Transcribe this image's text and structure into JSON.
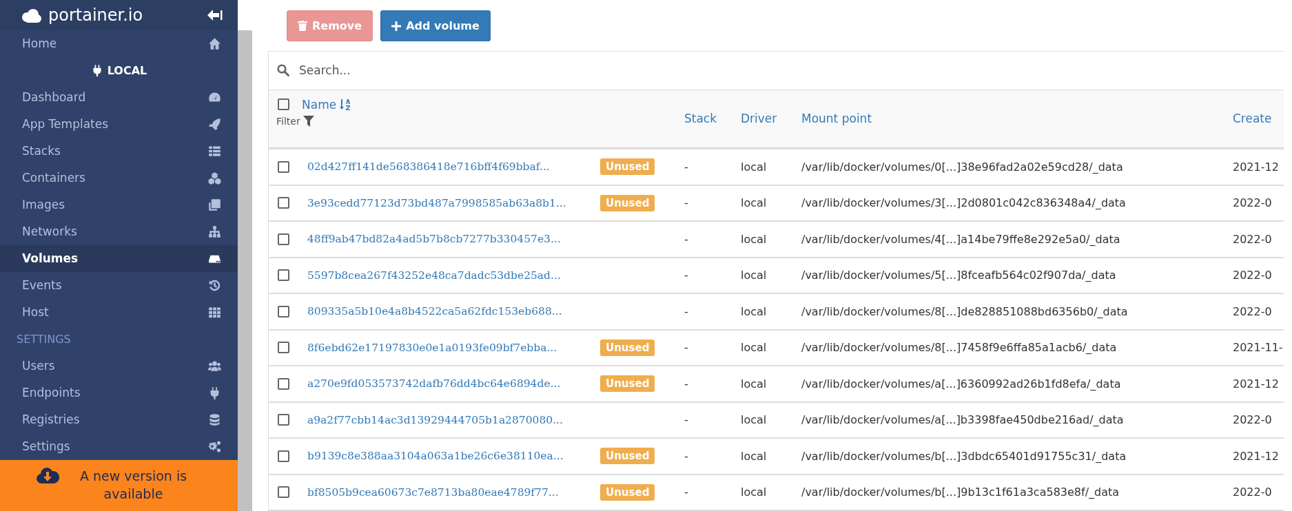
{
  "sidebar": {
    "logo": "portainer.io",
    "items": [
      {
        "kind": "link",
        "label": "Home",
        "selected": false
      },
      {
        "kind": "endpoint",
        "label": "LOCAL"
      },
      {
        "kind": "link",
        "label": "Dashboard",
        "selected": false
      },
      {
        "kind": "link",
        "label": "App Templates",
        "selected": false
      },
      {
        "kind": "link",
        "label": "Stacks",
        "selected": false
      },
      {
        "kind": "link",
        "label": "Containers",
        "selected": false
      },
      {
        "kind": "link",
        "label": "Images",
        "selected": false
      },
      {
        "kind": "link",
        "label": "Networks",
        "selected": false
      },
      {
        "kind": "link",
        "label": "Volumes",
        "selected": true
      },
      {
        "kind": "link",
        "label": "Events",
        "selected": false
      },
      {
        "kind": "link",
        "label": "Host",
        "selected": false
      },
      {
        "kind": "heading",
        "label": "SETTINGS"
      },
      {
        "kind": "link",
        "label": "Users",
        "selected": false
      },
      {
        "kind": "link",
        "label": "Endpoints",
        "selected": false
      },
      {
        "kind": "link",
        "label": "Registries",
        "selected": false
      },
      {
        "kind": "link",
        "label": "Settings",
        "selected": false
      }
    ],
    "update_notice": "A new version is available"
  },
  "toolbar": {
    "buttons": [
      {
        "kind": "remove",
        "label": "Remove",
        "disabled": true
      },
      {
        "kind": "add",
        "label": "Add volume",
        "disabled": false
      }
    ]
  },
  "search": {
    "placeholder": "Search..."
  },
  "table": {
    "select_all": {
      "checked": false
    },
    "filter": "Filter",
    "columns": [
      {
        "label": "Name"
      },
      {
        "label": "Stack"
      },
      {
        "label": "Driver"
      },
      {
        "label": "Mount point"
      },
      {
        "label": "Create"
      }
    ],
    "rows": [
      {
        "checked": false,
        "name": "02d427ff141de568386418e716bff4f69bbaf...",
        "badge": "Unused",
        "stack": "-",
        "driver": "local",
        "mount_point": "/var/lib/docker/volumes/0[...]38e96fad2a02e59cd28/_data",
        "created": "2021-12"
      },
      {
        "checked": false,
        "name": "3e93cedd77123d73bd487a7998585ab63a8b1...",
        "badge": "Unused",
        "stack": "-",
        "driver": "local",
        "mount_point": "/var/lib/docker/volumes/3[...]2d0801c042c836348a4/_data",
        "created": "2022-0"
      },
      {
        "checked": false,
        "name": "48ff9ab47bd82a4ad5b7b8cb7277b330457e3...",
        "stack": "-",
        "driver": "local",
        "mount_point": "/var/lib/docker/volumes/4[...]a14be79ffe8e292e5a0/_data",
        "created": "2022-0"
      },
      {
        "checked": false,
        "name": "5597b8cea267f43252e48ca7dadc53dbe25ad...",
        "stack": "-",
        "driver": "local",
        "mount_point": "/var/lib/docker/volumes/5[...]8fceafb564c02f907da/_data",
        "created": "2022-0"
      },
      {
        "checked": false,
        "name": "809335a5b10e4a8b4522ca5a62fdc153eb688...",
        "stack": "-",
        "driver": "local",
        "mount_point": "/var/lib/docker/volumes/8[...]de828851088bd6356b0/_data",
        "created": "2022-0"
      },
      {
        "checked": false,
        "name": "8f6ebd62e17197830e0e1a0193fe09bf7ebba...",
        "badge": "Unused",
        "stack": "-",
        "driver": "local",
        "mount_point": "/var/lib/docker/volumes/8[...]7458f9e6ffa85a1acb6/_data",
        "created": "2021-11-"
      },
      {
        "checked": false,
        "name": "a270e9fd053573742dafb76dd4bc64e6894de...",
        "badge": "Unused",
        "stack": "-",
        "driver": "local",
        "mount_point": "/var/lib/docker/volumes/a[...]6360992ad26b1fd8efa/_data",
        "created": "2021-12"
      },
      {
        "checked": false,
        "name": "a9a2f77cbb14ac3d13929444705b1a2870080...",
        "stack": "-",
        "driver": "local",
        "mount_point": "/var/lib/docker/volumes/a[...]b3398fae450dbe216ad/_data",
        "created": "2022-0"
      },
      {
        "checked": false,
        "name": "b9139c8e388aa3104a063a1be26c6e38110ea...",
        "badge": "Unused",
        "stack": "-",
        "driver": "local",
        "mount_point": "/var/lib/docker/volumes/b[...]3dbdc65401d91755c31/_data",
        "created": "2021-12"
      },
      {
        "checked": false,
        "name": "bf8505b9cea60673c7e8713ba80eae4789f77...",
        "badge": "Unused",
        "stack": "-",
        "driver": "local",
        "mount_point": "/var/lib/docker/volumes/b[...]9b13c1f61a3ca583e8f/_data",
        "created": "2022-0"
      }
    ]
  }
}
